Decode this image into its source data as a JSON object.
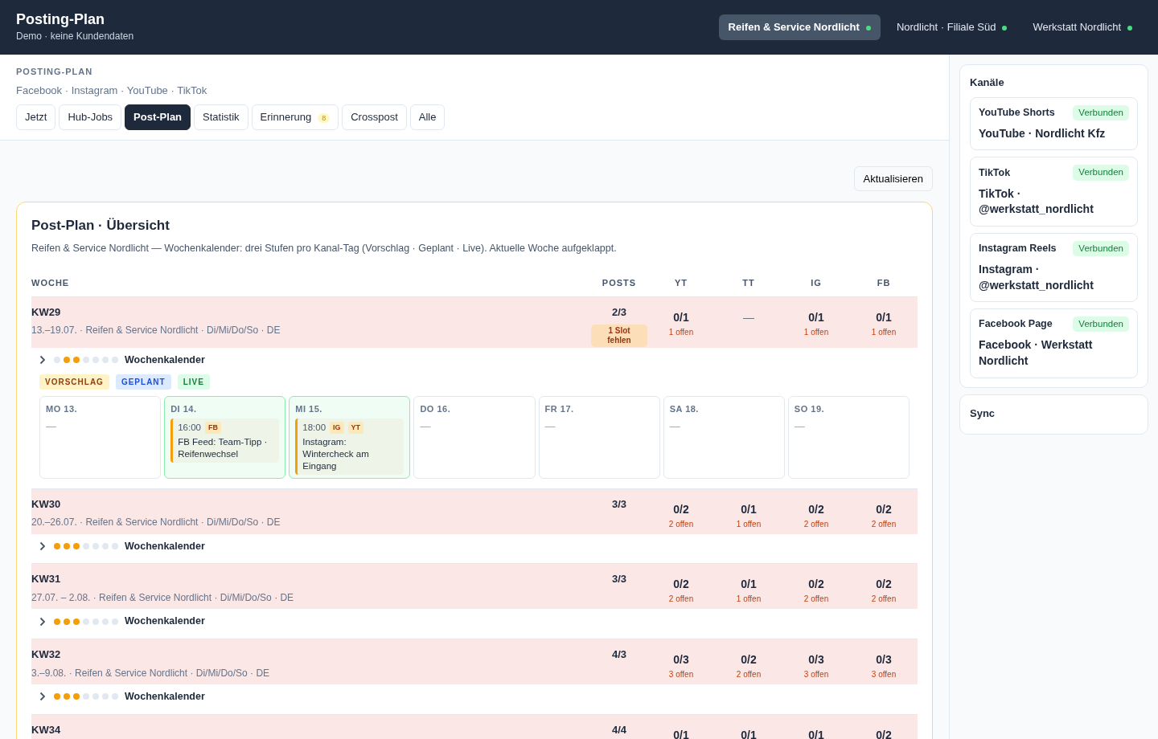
{
  "app": {
    "title": "Posting-Plan",
    "subtitle": "Demo · keine Kundendaten"
  },
  "accounts": [
    {
      "name": "Reifen & Service Nordlicht",
      "selected": true,
      "online": true
    },
    {
      "name": "Nordlicht · Filiale Süd",
      "selected": false,
      "online": true
    },
    {
      "name": "Werkstatt Nordlicht",
      "selected": false,
      "online": true
    }
  ],
  "section": {
    "eyebrow": "POSTING-PLAN",
    "platforms": "Facebook · Instagram · YouTube · TikTok"
  },
  "tabs": [
    {
      "label": "Jetzt",
      "selected": false
    },
    {
      "label": "Hub-Jobs",
      "selected": false
    },
    {
      "label": "Post-Plan",
      "selected": true
    },
    {
      "label": "Statistik",
      "selected": false
    },
    {
      "label": "Erinnerung",
      "selected": false,
      "badge": "8"
    },
    {
      "label": "Crosspost",
      "selected": false
    },
    {
      "label": "Alle",
      "selected": false
    }
  ],
  "refresh_button": "Aktualisieren",
  "overview": {
    "title": "Post-Plan · Übersicht",
    "description": "Reifen & Service Nordlicht — Wochenkalender: drei Stufen pro Kanal-Tag (Vorschlag · Geplant · Live). Aktuelle Woche aufgeklappt.",
    "columns": [
      "WOCHE",
      "POSTS",
      "YT",
      "TT",
      "IG",
      "FB"
    ],
    "legend": [
      {
        "label": "VORSCHLAG",
        "kind": "vorschlag"
      },
      {
        "label": "GEPLANT",
        "kind": "geplant"
      },
      {
        "label": "LIVE",
        "kind": "live"
      }
    ],
    "weeks": [
      {
        "week": "KW29",
        "meta": "13.–19.07. · Reifen & Service Nordlicht · Di/Mi/Do/So · DE",
        "posts": {
          "value": "2/3",
          "badge": "1 Slot fehlen"
        },
        "channels": [
          {
            "value": "0/1",
            "note": "1 offen"
          },
          {
            "value": "—"
          },
          {
            "value": "0/1",
            "note": "1 offen"
          },
          {
            "value": "0/1",
            "note": "1 offen"
          }
        ],
        "dots": [
          {
            "filled": false
          },
          {
            "filled": true
          },
          {
            "filled": true
          },
          {
            "filled": false
          },
          {
            "filled": false
          },
          {
            "filled": false
          },
          {
            "filled": false
          }
        ],
        "calendar_label": "Wochenkalender",
        "days": [
          {
            "label": "MO 13.",
            "highlighted": false,
            "empty": "—"
          },
          {
            "label": "DI 14.",
            "highlighted": true,
            "posts": [
              {
                "time": "16:00",
                "kind": "vorschlag",
                "tags": [
                  "FB"
                ],
                "text": "FB Feed: Team-Tipp · Reifenwechsel"
              }
            ]
          },
          {
            "label": "MI 15.",
            "highlighted": true,
            "posts": [
              {
                "time": "18:00",
                "kind": "vorschlag",
                "tags": [
                  "IG",
                  "YT"
                ],
                "text": "Instagram: Wintercheck am Eingang"
              }
            ]
          },
          {
            "label": "DO 16.",
            "highlighted": false,
            "empty": "—"
          },
          {
            "label": "FR 17.",
            "highlighted": false,
            "empty": "—"
          },
          {
            "label": "SA 18.",
            "highlighted": false,
            "empty": "—"
          },
          {
            "label": "SO 19.",
            "highlighted": false,
            "empty": "—"
          }
        ]
      },
      {
        "week": "KW30",
        "meta": "20.–26.07. · Reifen & Service Nordlicht · Di/Mi/Do/So · DE",
        "posts": {
          "value": "3/3"
        },
        "channels": [
          {
            "value": "0/2",
            "note": "2 offen"
          },
          {
            "value": "0/1",
            "note": "1 offen"
          },
          {
            "value": "0/2",
            "note": "2 offen"
          },
          {
            "value": "0/2",
            "note": "2 offen"
          }
        ],
        "dots": [
          {
            "filled": true
          },
          {
            "filled": true
          },
          {
            "filled": true
          },
          {
            "filled": false
          },
          {
            "filled": false
          },
          {
            "filled": false
          },
          {
            "filled": false
          }
        ],
        "calendar_label": "Wochenkalender"
      },
      {
        "week": "KW31",
        "meta": "27.07. – 2.08. · Reifen & Service Nordlicht · Di/Mi/Do/So · DE",
        "posts": {
          "value": "3/3"
        },
        "channels": [
          {
            "value": "0/2",
            "note": "2 offen"
          },
          {
            "value": "0/1",
            "note": "1 offen"
          },
          {
            "value": "0/2",
            "note": "2 offen"
          },
          {
            "value": "0/2",
            "note": "2 offen"
          }
        ],
        "dots": [
          {
            "filled": true
          },
          {
            "filled": true
          },
          {
            "filled": true
          },
          {
            "filled": false
          },
          {
            "filled": false
          },
          {
            "filled": false
          },
          {
            "filled": false
          }
        ],
        "calendar_label": "Wochenkalender"
      },
      {
        "week": "KW32",
        "meta": "3.–9.08. · Reifen & Service Nordlicht · Di/Mi/Do/So · DE",
        "posts": {
          "value": "4/3"
        },
        "channels": [
          {
            "value": "0/3",
            "note": "3 offen"
          },
          {
            "value": "0/2",
            "note": "2 offen"
          },
          {
            "value": "0/3",
            "note": "3 offen"
          },
          {
            "value": "0/3",
            "note": "3 offen"
          }
        ],
        "dots": [
          {
            "filled": true
          },
          {
            "filled": true
          },
          {
            "filled": true
          },
          {
            "filled": false
          },
          {
            "filled": false
          },
          {
            "filled": false
          },
          {
            "filled": false
          }
        ],
        "calendar_label": "Wochenkalender"
      },
      {
        "week": "KW34",
        "posts": {
          "value": "4/4"
        },
        "channels": [
          {
            "value": "0/1"
          },
          {
            "value": "0/1"
          },
          {
            "value": "0/1"
          },
          {
            "value": "0/2"
          }
        ]
      }
    ]
  },
  "sidebar": {
    "channels_title": "Kanäle",
    "channels": [
      {
        "name": "YouTube Shorts",
        "status": "Verbunden",
        "account": "YouTube · Nordlicht Kfz"
      },
      {
        "name": "TikTok",
        "status": "Verbunden",
        "account": "TikTok · @werkstatt_nordlicht"
      },
      {
        "name": "Instagram Reels",
        "status": "Verbunden",
        "account": "Instagram · @werkstatt_nordlicht"
      },
      {
        "name": "Facebook Page",
        "status": "Verbunden",
        "account": "Facebook · Werkstatt Nordlicht"
      }
    ],
    "sync_title": "Sync"
  }
}
